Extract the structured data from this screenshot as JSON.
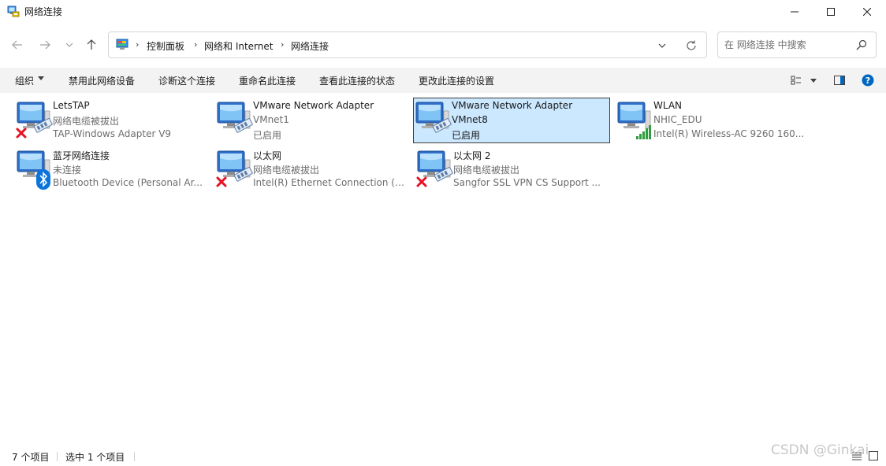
{
  "window": {
    "title": "网络连接",
    "controls": [
      "minimize",
      "maximize",
      "close"
    ]
  },
  "breadcrumb": {
    "items": [
      "控制面板",
      "网络和 Internet",
      "网络连接"
    ]
  },
  "search": {
    "placeholder": "在 网络连接 中搜索"
  },
  "toolbar": {
    "organize_label": "组织",
    "commands": [
      "禁用此网络设备",
      "诊断这个连接",
      "重命名此连接",
      "查看此连接的状态",
      "更改此连接的设置"
    ]
  },
  "connections": [
    {
      "name": "LetsTAP",
      "status": "网络电缆被拔出",
      "device": "TAP-Windows Adapter V9",
      "badge": "disconnected-x",
      "selected": false
    },
    {
      "name": "VMware Network Adapter",
      "status": "VMnet1",
      "device": "已启用",
      "badge": "none",
      "selected": false
    },
    {
      "name": "VMware Network Adapter",
      "status": "VMnet8",
      "device": "已启用",
      "badge": "none",
      "selected": true
    },
    {
      "name": "WLAN",
      "status": "NHIC_EDU",
      "device": "Intel(R) Wireless-AC 9260 160...",
      "badge": "wifi-signal",
      "selected": false
    },
    {
      "name": "蓝牙网络连接",
      "status": "未连接",
      "device": "Bluetooth Device (Personal Ar...",
      "badge": "bluetooth",
      "selected": false
    },
    {
      "name": "以太网",
      "status": "网络电缆被拔出",
      "device": "Intel(R) Ethernet Connection (6...",
      "badge": "disconnected-x",
      "selected": false
    },
    {
      "name": "以太网 2",
      "status": "网络电缆被拔出",
      "device": "Sangfor SSL VPN CS Support ...",
      "badge": "disconnected-x",
      "selected": false
    }
  ],
  "statusbar": {
    "item_count": "7 个项目",
    "selected_count": "选中 1 个项目"
  },
  "watermark": "CSDN @Ginkai",
  "colors": {
    "selection_bg": "#cce8ff",
    "help_blue": "#0067c0",
    "error_red": "#e81123",
    "wifi_green": "#2e9e3e"
  }
}
